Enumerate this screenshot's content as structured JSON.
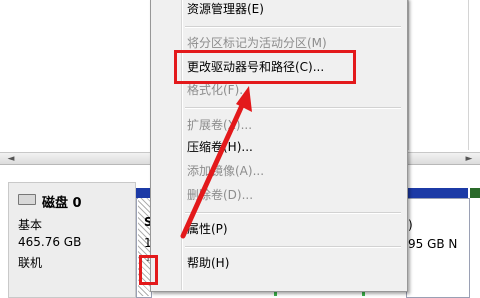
{
  "context_menu": {
    "items": [
      {
        "label": "资源管理器(E)",
        "enabled": true
      },
      {
        "label": "将分区标记为活动分区(M)",
        "enabled": false
      },
      {
        "label": "更改驱动器号和路径(C)...",
        "enabled": true,
        "highlighted": true
      },
      {
        "label": "格式化(F)...",
        "enabled": false
      },
      {
        "label": "扩展卷(X)...",
        "enabled": false
      },
      {
        "label": "压缩卷(H)...",
        "enabled": true
      },
      {
        "label": "添加镜像(A)...",
        "enabled": false
      },
      {
        "label": "删除卷(D)...",
        "enabled": false
      },
      {
        "label": "属性(P)",
        "enabled": true
      },
      {
        "label": "帮助(H)",
        "enabled": true
      }
    ]
  },
  "disk": {
    "name": "磁盘 0",
    "type": "基本",
    "size": "465.76 GB",
    "status": "联机"
  },
  "partitions": {
    "first_letter": "S",
    "first_digit": "1",
    "first_mark": "¹",
    "right_letter": ")",
    "right_size": "95 GB N"
  },
  "colors": {
    "annotation": "#e3191b",
    "primary_partition": "#1c3aa6",
    "menu_background": "#f0f0f0"
  }
}
